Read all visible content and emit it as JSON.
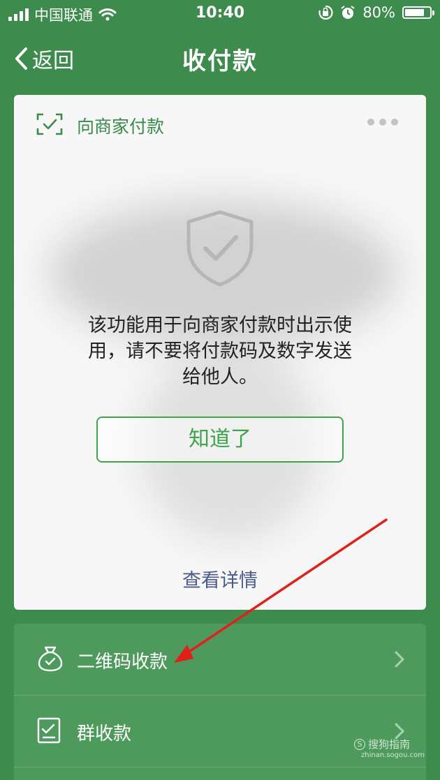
{
  "status_bar": {
    "carrier": "中国联通",
    "time": "10:40",
    "battery_percent": "80%",
    "battery_level": 0.8
  },
  "nav": {
    "back_label": "返回",
    "title": "收付款"
  },
  "pay_card": {
    "title": "向商家付款",
    "notice_line1": "该功能用于向商家付款时出示使",
    "notice_line2": "用，请不要将付款码及数字发送",
    "notice_line3": "给他人。",
    "ok_button": "知道了",
    "detail_link": "查看详情"
  },
  "menu": {
    "items": [
      {
        "label": "二维码收款",
        "icon": "money-bag-icon"
      },
      {
        "label": "群收款",
        "icon": "group-bill-icon"
      }
    ]
  },
  "watermark": {
    "brand": "搜狗指南",
    "logo_letter": "S",
    "url": "zhinan.sogou.com"
  },
  "colors": {
    "background_green": "#3e8b4e",
    "accent_green": "#3fa34d",
    "arrow_red": "#e0201a"
  }
}
